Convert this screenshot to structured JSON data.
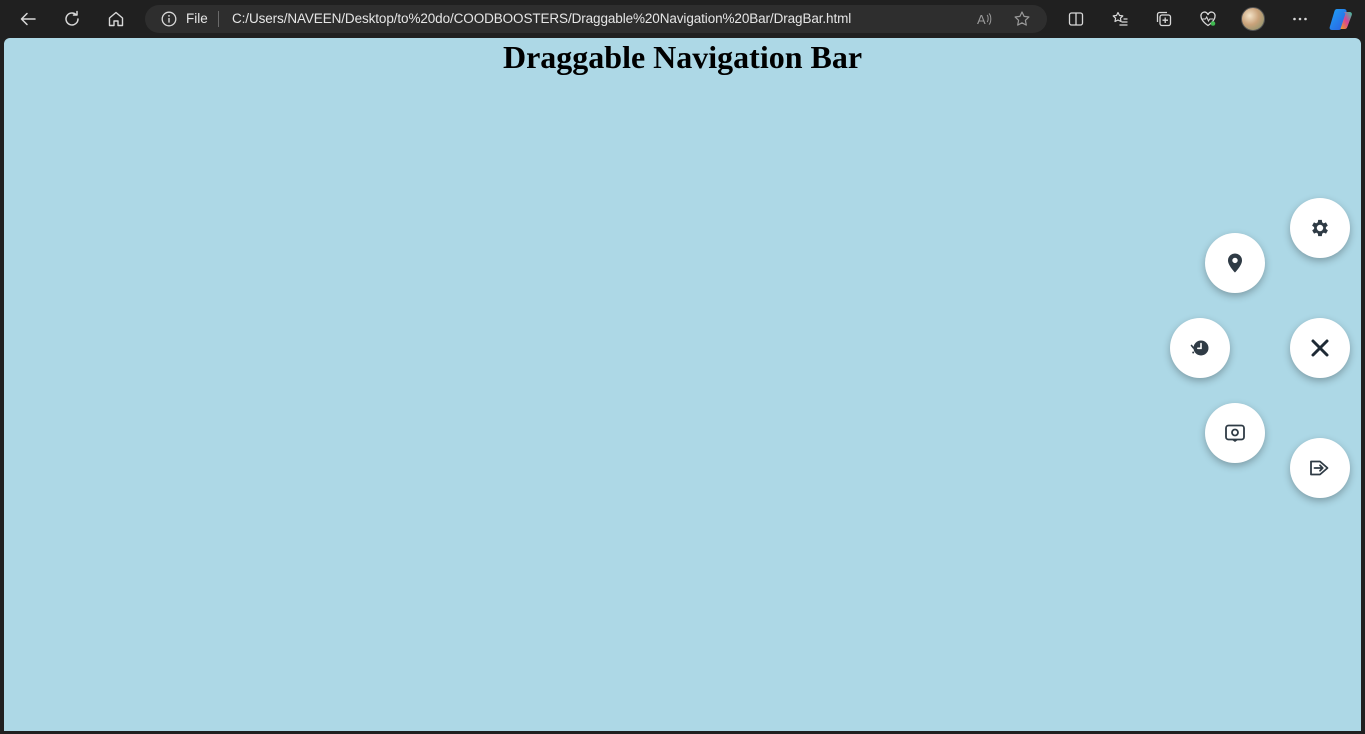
{
  "browser": {
    "address_scheme": "File",
    "address_url": "C:/Users/NAVEEN/Desktop/to%20do/COODBOOSTERS/Draggable%20Navigation%20Bar/DragBar.html"
  },
  "page": {
    "title": "Draggable Navigation Bar",
    "background_color": "#add8e6"
  },
  "nav_buttons": [
    {
      "name": "settings",
      "icon": "gear-icon"
    },
    {
      "name": "location",
      "icon": "map-pin-icon"
    },
    {
      "name": "history",
      "icon": "clock-history-icon"
    },
    {
      "name": "close",
      "icon": "close-icon"
    },
    {
      "name": "preview",
      "icon": "eye-screen-icon"
    },
    {
      "name": "logout",
      "icon": "logout-arrow-icon"
    }
  ],
  "icon_color": "#2f3b45"
}
